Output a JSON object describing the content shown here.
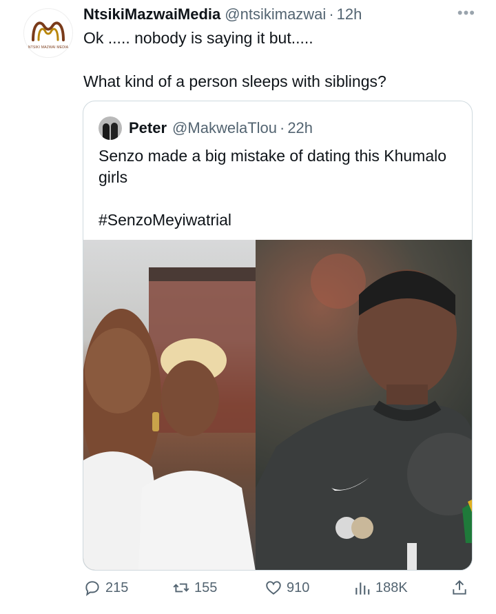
{
  "tweet": {
    "author_name": "NtsikiMazwaiMedia",
    "author_handle": "@ntsikimazwai",
    "separator": "·",
    "time": "12h",
    "more": "•••",
    "avatar_logo_text": "NTSIKI MAZWAI MEDIA",
    "text_line1": "Ok ..... nobody is saying it but.....",
    "text_line2": "What kind of a person sleeps with siblings?"
  },
  "quote": {
    "author_name": "Peter",
    "author_handle": "@MakwelaTlou",
    "separator": "·",
    "time": "22h",
    "text": "Senzo made a big mistake of dating this Khumalo girls",
    "hashtag": "#SenzoMeyiwatrial"
  },
  "actions": {
    "replies": "215",
    "retweets": "155",
    "likes": "910",
    "views": "188K"
  },
  "colors": {
    "text_primary": "#0f1419",
    "text_secondary": "#536471",
    "border": "#cfd9de",
    "logo_brown": "#7a3b1a"
  }
}
